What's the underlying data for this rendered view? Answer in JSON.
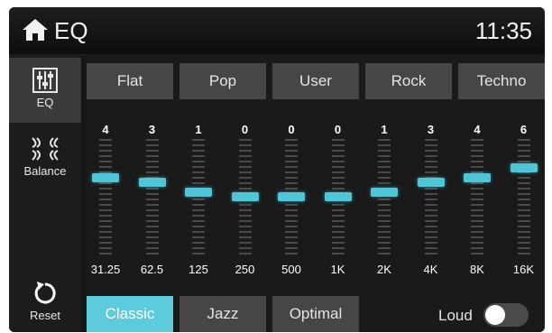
{
  "titlebar": {
    "title": "EQ",
    "time": "11:35",
    "home_icon": "home-icon"
  },
  "sidebar": {
    "items": [
      {
        "label": "EQ",
        "icon": "equalizer-icon",
        "active": true
      },
      {
        "label": "Balance",
        "icon": "balance-icon",
        "active": false
      },
      {
        "label": "Reset",
        "icon": "reset-icon",
        "active": false
      }
    ]
  },
  "presets": {
    "top": [
      "Flat",
      "Pop",
      "User",
      "Rock",
      "Techno"
    ],
    "bottom": [
      "Classic",
      "Jazz",
      "Optimal"
    ],
    "selected": "Classic"
  },
  "bands": [
    {
      "freq": "31.25",
      "gain": "4"
    },
    {
      "freq": "62.5",
      "gain": "3"
    },
    {
      "freq": "125",
      "gain": "1"
    },
    {
      "freq": "250",
      "gain": "0"
    },
    {
      "freq": "500",
      "gain": "0"
    },
    {
      "freq": "1K",
      "gain": "0"
    },
    {
      "freq": "2K",
      "gain": "1"
    },
    {
      "freq": "4K",
      "gain": "3"
    },
    {
      "freq": "8K",
      "gain": "4"
    },
    {
      "freq": "16K",
      "gain": "6"
    }
  ],
  "loud": {
    "label": "Loud",
    "enabled": false
  },
  "colors": {
    "accent": "#5ccbdc",
    "background": "#161616",
    "button": "#464646"
  }
}
